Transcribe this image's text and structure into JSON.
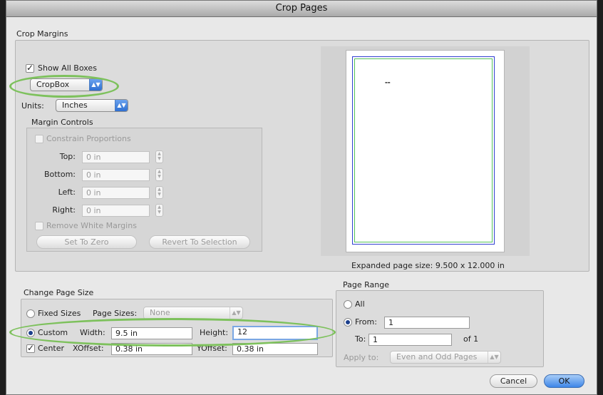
{
  "window": {
    "title": "Crop Pages"
  },
  "crop_margins": {
    "group_label": "Crop Margins",
    "show_all_boxes": {
      "label": "Show All Boxes",
      "checked": true
    },
    "box_select": {
      "value": "CropBox"
    },
    "units": {
      "label": "Units:",
      "value": "Inches"
    },
    "margin_controls": {
      "label": "Margin Controls",
      "constrain": {
        "label": "Constrain Proportions",
        "checked": false
      },
      "fields": [
        {
          "label": "Top:",
          "value": "0 in"
        },
        {
          "label": "Bottom:",
          "value": "0 in"
        },
        {
          "label": "Left:",
          "value": "0 in"
        },
        {
          "label": "Right:",
          "value": "0 in"
        }
      ],
      "remove_white": {
        "label": "Remove White Margins",
        "checked": false
      },
      "set_to_zero": "Set To Zero",
      "revert": "Revert To Selection"
    },
    "preview": {
      "page_text": "▬▬",
      "expanded_size": "Expanded page size: 9.500 x 12.000 in"
    }
  },
  "change_page_size": {
    "group_label": "Change Page Size",
    "fixed": {
      "label": "Fixed Sizes",
      "selected": false
    },
    "page_sizes": {
      "label": "Page Sizes:",
      "value": "None"
    },
    "custom": {
      "label": "Custom",
      "selected": true
    },
    "width": {
      "label": "Width:",
      "value": "9.5 in"
    },
    "height": {
      "label": "Height:",
      "value": "12"
    },
    "center": {
      "label": "Center",
      "checked": true
    },
    "xoffset": {
      "label": "XOffset:",
      "value": "0.38 in"
    },
    "yoffset": {
      "label": "YOffset:",
      "value": "0.38 in"
    }
  },
  "page_range": {
    "group_label": "Page Range",
    "all": {
      "label": "All",
      "selected": false
    },
    "from": {
      "label": "From:",
      "value": "1",
      "selected": true
    },
    "to": {
      "label": "To:",
      "value": "1"
    },
    "of_label": "of 1",
    "apply_to": {
      "label": "Apply to:",
      "value": "Even and Odd Pages"
    }
  },
  "buttons": {
    "cancel": "Cancel",
    "ok": "OK"
  },
  "colors": {
    "highlight_oval": "#7dc15c",
    "default_button": "#3d86e8",
    "focus_ring": "#7aa7e4"
  },
  "icons": {
    "checkmark": "checkmark-icon",
    "popup_arrows": "updown-arrows-icon"
  }
}
